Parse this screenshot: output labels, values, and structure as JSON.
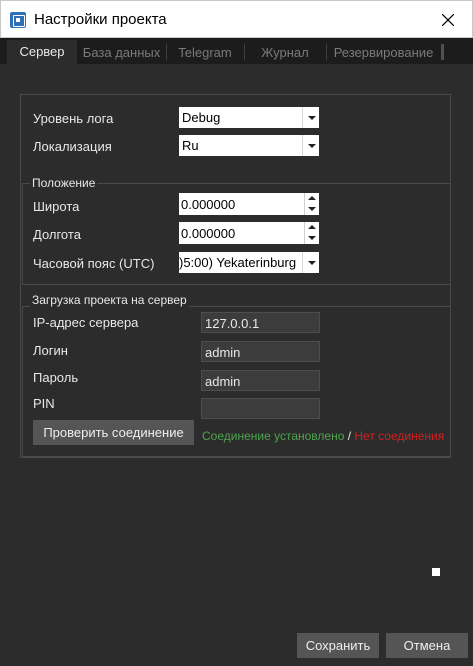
{
  "window": {
    "title": "Настройки проекта"
  },
  "tabs": [
    {
      "label": "Сервер",
      "active": true
    },
    {
      "label": "База данных",
      "active": false
    },
    {
      "label": "Telegram",
      "active": false
    },
    {
      "label": "Журнал",
      "active": false
    },
    {
      "label": "Резервирование",
      "active": false
    }
  ],
  "general": {
    "log_level": {
      "label": "Уровень лога",
      "value": "Debug"
    },
    "localization": {
      "label": "Локализация",
      "value": "Ru"
    }
  },
  "position": {
    "title": "Положение",
    "latitude": {
      "label": "Широта",
      "value": "0.000000"
    },
    "longitude": {
      "label": "Долгота",
      "value": "0.000000"
    },
    "timezone": {
      "label": "Часовой пояс (UTC)",
      "value": ")5:00) Yekaterinburg"
    }
  },
  "upload": {
    "title": "Загрузка проекта на сервер",
    "server_ip": {
      "label": "IP-адрес сервера",
      "value": "127.0.0.1"
    },
    "login": {
      "label": "Логин",
      "value": "admin"
    },
    "password": {
      "label": "Пароль",
      "value": "admin"
    },
    "pin": {
      "label": "PIN",
      "value": ""
    },
    "check_button": "Проверить соединение",
    "status_ok": "Соединение установлено",
    "status_separator": " / ",
    "status_fail": "Нет соединения"
  },
  "footer": {
    "save_button": "Сохранить",
    "cancel_button": "Отмена"
  },
  "colors": {
    "background": "#2c2c2c",
    "tabbar": "#1c1c1c",
    "status_ok": "#4da34d",
    "status_fail": "#d02020",
    "button": "#555555"
  }
}
